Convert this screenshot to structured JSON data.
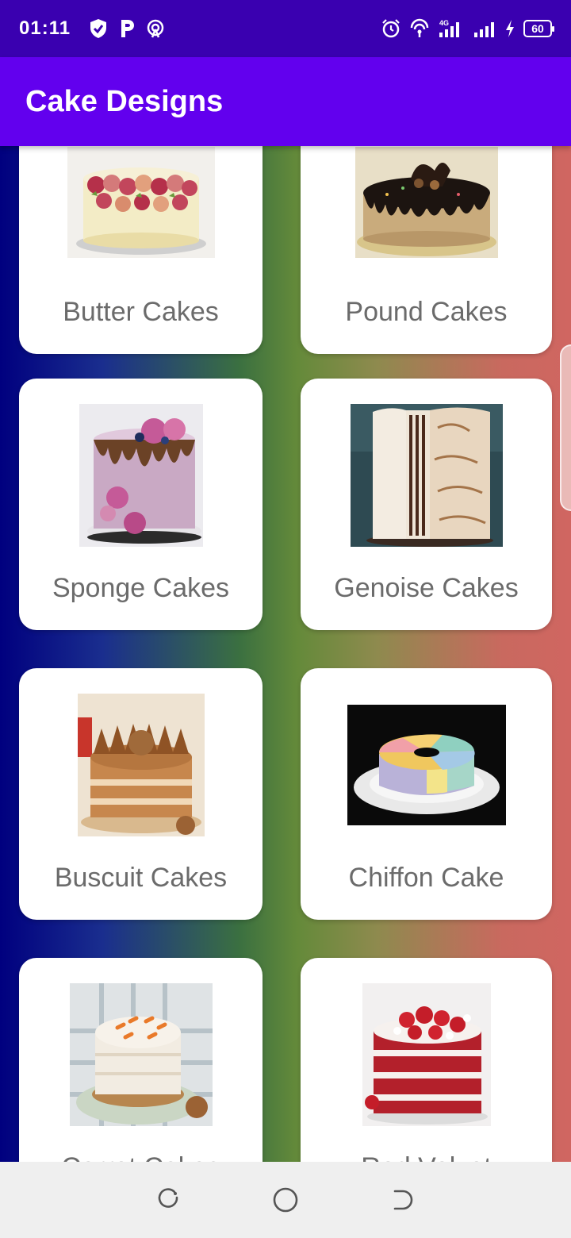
{
  "status_bar": {
    "time": "01:11",
    "battery": "60",
    "network": "4G"
  },
  "app_bar": {
    "title": "Cake Designs"
  },
  "cakes": [
    {
      "label": "Butter Cakes",
      "image": "butter-cake-image"
    },
    {
      "label": "Pound Cakes",
      "image": "pound-cake-image"
    },
    {
      "label": "Sponge Cakes",
      "image": "sponge-cake-image"
    },
    {
      "label": "Genoise Cakes",
      "image": "genoise-cake-image"
    },
    {
      "label": "Buscuit Cakes",
      "image": "biscuit-cake-image"
    },
    {
      "label": "Chiffon Cake",
      "image": "chiffon-cake-image"
    },
    {
      "label": "Carrot Cakes",
      "image": "carrot-cake-image"
    },
    {
      "label": "Red Velvet",
      "image": "red-velvet-cake-image"
    }
  ],
  "nav_bar": {
    "icons": [
      "recent-apps-icon",
      "home-icon",
      "back-icon"
    ]
  },
  "colors": {
    "status_bar": "#3a00b0",
    "app_bar": "#6200ee",
    "card": "#ffffff",
    "label_text": "#6b6b6b"
  }
}
